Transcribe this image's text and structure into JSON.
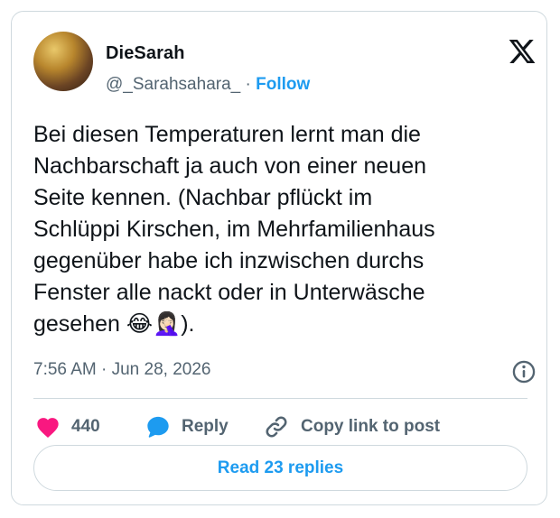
{
  "author": {
    "display_name": "DieSarah",
    "handle": "@_Sarahsahara_",
    "separator": "·",
    "follow_label": "Follow"
  },
  "tweet": {
    "text": "Bei diesen Temperaturen lernt man die\nNachbarschaft ja auch von einer neuen\nSeite kennen. (Nachbar pflückt im\nSchlüppi Kirschen, im Mehrfamilienhaus\ngegenüber habe ich inzwischen durchs\nFenster alle nackt oder in Unterwäsche\ngesehen 😂🤦🏻‍♀️).",
    "time": "7:56 AM",
    "date_separator": "·",
    "date": "Jun 28, 2026"
  },
  "actions": {
    "like_count": "440",
    "reply_label": "Reply",
    "copy_link_label": "Copy link to post"
  },
  "read_replies_label": "Read 23 replies",
  "icons": {
    "brand": "x-logo-icon",
    "info": "info-icon",
    "like": "heart-icon",
    "reply": "speech-bubble-icon",
    "copy": "link-icon"
  },
  "colors": {
    "accent": "#1d9bf0",
    "like": "#f91880",
    "secondary_text": "#536471",
    "border": "#cfd9de"
  }
}
